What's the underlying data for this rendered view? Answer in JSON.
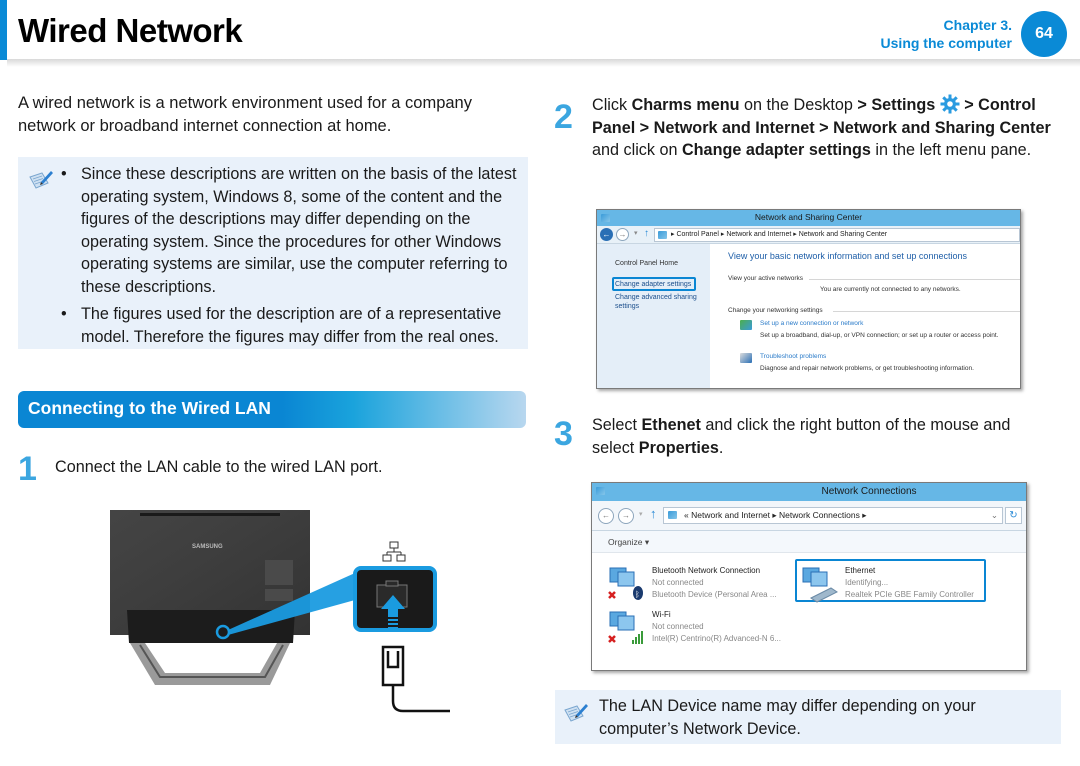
{
  "header": {
    "title": "Wired Network",
    "chapter": "Chapter 3.",
    "chapter_title": "Using the computer",
    "page_number": "64",
    "accent_color": "#0a8ad6"
  },
  "intro": "A wired network is a network environment used for a company network or broadband internet connection at home.",
  "note_top": {
    "icon": "note-pencil-icon",
    "bullets": [
      "Since these descriptions are written on the basis of the latest operating system, Windows 8, some of the content and the figures of the descriptions may differ depending on the operating system. Since the procedures for other Windows operating systems are similar, use the computer referring to these descriptions.",
      "The figures used for the description are of a representative model. Therefore the figures may differ from the real ones."
    ]
  },
  "section": {
    "title": "Connecting to the Wired LAN"
  },
  "steps": [
    {
      "number": "1",
      "segments": [
        {
          "text": "Connect the LAN cable to the wired LAN port.",
          "bold": false
        }
      ]
    },
    {
      "number": "2",
      "segments": [
        {
          "text": "Click ",
          "bold": false
        },
        {
          "text": "Charms menu",
          "bold": true
        },
        {
          "text": " on the Desktop ",
          "bold": false
        },
        {
          "text": "> Settings ",
          "bold": true
        },
        {
          "text": "__GEAR__",
          "bold": false
        },
        {
          "text": " > Control Panel > Network and Internet > Network and Sharing Center",
          "bold": true
        },
        {
          "text": " and click on ",
          "bold": false
        },
        {
          "text": "Change adapter settings",
          "bold": true
        },
        {
          "text": " in the left menu pane.",
          "bold": false
        }
      ]
    },
    {
      "number": "3",
      "segments": [
        {
          "text": "Select ",
          "bold": false
        },
        {
          "text": "Ethenet",
          "bold": true
        },
        {
          "text": " and click the right button of the mouse and select ",
          "bold": false
        },
        {
          "text": "Properties",
          "bold": true
        },
        {
          "text": ".",
          "bold": false
        }
      ]
    }
  ],
  "illustration": {
    "brand_label": "SAMSUNG",
    "port_icon": "network-port-icon"
  },
  "sharing_center_window": {
    "title": "Network and Sharing Center",
    "breadcrumb": [
      "Control Panel",
      "Network and Internet",
      "Network and Sharing Center"
    ],
    "left_links": [
      "Control Panel Home",
      "Change adapter settings",
      "Change advanced sharing settings"
    ],
    "heading": "View your basic network information and set up connections",
    "active_networks_label": "View your active networks",
    "not_connected_msg": "You are currently not connected to any networks.",
    "change_settings_label": "Change your networking settings",
    "tasks": [
      {
        "link": "Set up a new connection or network",
        "desc": "Set up a broadband, dial-up, or VPN connection; or set up a router or access point."
      },
      {
        "link": "Troubleshoot problems",
        "desc": "Diagnose and repair network problems, or get troubleshooting information."
      }
    ]
  },
  "connections_window": {
    "title": "Network Connections",
    "breadcrumb_prefix": "«",
    "breadcrumb": [
      "Network and Internet",
      "Network Connections"
    ],
    "organize_label": "Organize ▾",
    "connections": [
      {
        "name": "Bluetooth Network Connection",
        "status": "Not connected",
        "device": "Bluetooth Device (Personal Area ..."
      },
      {
        "name": "Ethernet",
        "status": "Identifying...",
        "device": "Realtek PCIe GBE Family Controller"
      },
      {
        "name": "Wi-Fi",
        "status": "Not connected",
        "device": "Intel(R) Centrino(R) Advanced-N 6..."
      }
    ]
  },
  "note_bottom": {
    "icon": "note-pencil-icon",
    "text": "The LAN Device name may differ depending on your computer’s Network Device."
  }
}
